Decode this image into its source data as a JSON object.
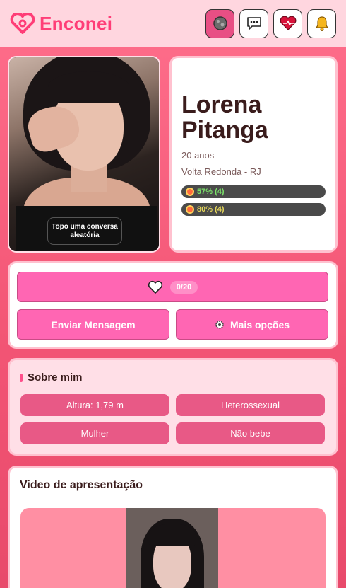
{
  "header": {
    "brand": "Enconei",
    "icons": [
      "logo-heart-icon",
      "theme-toggle-icon",
      "chat-icon",
      "matches-heart-icon",
      "notification-bell-icon"
    ]
  },
  "profile": {
    "name_line1": "Lorena",
    "name_line2": "Pitanga",
    "age": "20 anos",
    "location": "Volta Redonda - RJ",
    "photo_badge": "Topo uma conversa aleatória",
    "meters": [
      {
        "label": "57% (4)",
        "color": "#7be36a"
      },
      {
        "label": "80% (4)",
        "color": "#e8d95a"
      }
    ]
  },
  "actions": {
    "like_count": "0/20",
    "send_message": "Enviar Mensagem",
    "more_options": "Mais opções"
  },
  "about": {
    "title": "Sobre mim",
    "chips": [
      "Altura: 1,79 m",
      "Heterossexual",
      "Mulher",
      "Não bebe"
    ]
  },
  "video": {
    "title": "Video de apresentação"
  },
  "colors": {
    "brand": "#ff3d77",
    "button": "#ff66b3",
    "chip": "#e85986"
  }
}
